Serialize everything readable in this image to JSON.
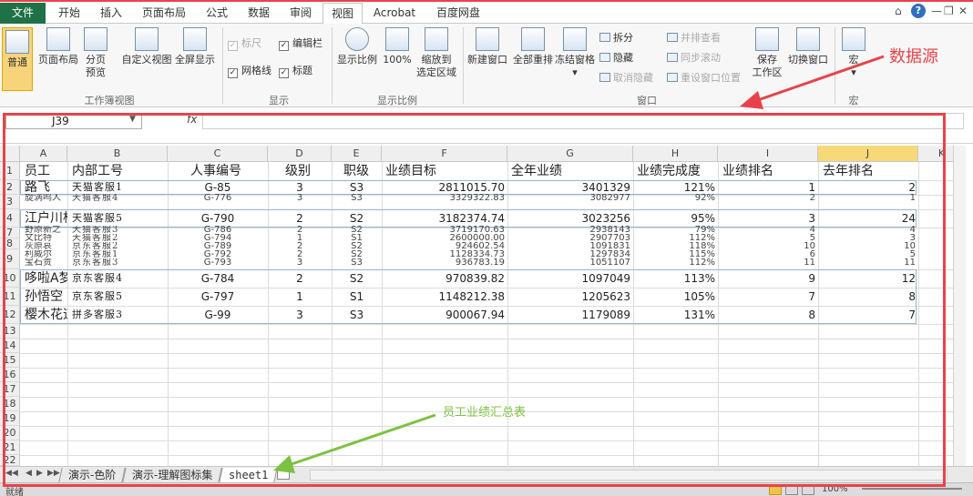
{
  "tabs": [
    "文件",
    "开始",
    "插入",
    "页面布局",
    "公式",
    "数据",
    "审阅",
    "视图",
    "Acrobat",
    "百度网盘"
  ],
  "ribbon": {
    "workbook_views": {
      "label": "工作簿视图",
      "normal": "普通",
      "page_layout": "页面布局",
      "page_break_1": "分页",
      "page_break_2": "预览",
      "custom_views": "自定义视图",
      "full_screen": "全屏显示"
    },
    "show": {
      "label": "显示",
      "ruler": "标尺",
      "formula_bar": "编辑栏",
      "gridlines": "网格线",
      "headings": "标题"
    },
    "zoom": {
      "label": "显示比例",
      "zoom": "显示比例",
      "hundred": "100%",
      "to_selection_1": "缩放到",
      "to_selection_2": "选定区域"
    },
    "window": {
      "label": "窗口",
      "new_window": "新建窗口",
      "arrange_all": "全部重排",
      "freeze_panes": "冻结窗格",
      "split": "拆分",
      "hide": "隐藏",
      "unhide": "取消隐藏",
      "side_by_side": "并排查看",
      "sync_scroll": "同步滚动",
      "reset_position": "重设窗口位置",
      "save_workspace_1": "保存",
      "save_workspace_2": "工作区",
      "switch_windows": "切换窗口"
    },
    "macros": {
      "label": "宏",
      "macro": "宏"
    }
  },
  "name_box": "J39",
  "fx": "fx",
  "columns": [
    "A",
    "B",
    "C",
    "D",
    "E",
    "F",
    "G",
    "H",
    "I",
    "J",
    "K"
  ],
  "row_numbers": [
    "1",
    "2",
    "3",
    "4",
    "7",
    "8",
    "9",
    "10",
    "11",
    "12",
    "13",
    "14",
    "15",
    "16",
    "17",
    "18",
    "19",
    "20",
    "21",
    "22"
  ],
  "headers": [
    "员工",
    "内部工号",
    "人事编号",
    "级别",
    "职级",
    "业绩目标",
    "全年业绩",
    "业绩完成度",
    "业绩排名",
    "去年排名"
  ],
  "rows": [
    [
      "路飞",
      "天猫客服1",
      "G-85",
      "3",
      "S3",
      "2811015.70",
      "3401329",
      "121%",
      "1",
      "2"
    ],
    [
      "旋涡鸣人",
      "天猫客服4",
      "G-776",
      "3",
      "S3",
      "3329322.83",
      "3082977",
      "92%",
      "2",
      "1"
    ],
    [
      "江户川柯",
      "天猫客服5",
      "G-790",
      "2",
      "S2",
      "3182374.74",
      "3023256",
      "95%",
      "3",
      "24"
    ],
    [
      "哆啦A梦",
      "京东客服4",
      "G-784",
      "2",
      "S2",
      "970839.82",
      "1097049",
      "113%",
      "9",
      "12"
    ],
    [
      "孙悟空",
      "京东客服5",
      "G-797",
      "1",
      "S1",
      "1148212.38",
      "1205623",
      "105%",
      "7",
      "8"
    ],
    [
      "樱木花道",
      "拼多客服3",
      "G-99",
      "3",
      "S3",
      "900067.94",
      "1179089",
      "131%",
      "8",
      "7"
    ]
  ],
  "overlap_rows": [
    [
      "野原新之",
      "天猫客服3",
      "G-786",
      "2",
      "S2",
      "3719170.63",
      "2938143",
      "79%",
      "4",
      "4"
    ],
    [
      "文比特",
      "天猫客服2",
      "G-794",
      "1",
      "S1",
      "2600000.00",
      "2907703",
      "112%",
      "5",
      "3"
    ],
    [
      "灰原哀",
      "京东客服2",
      "G-789",
      "2",
      "S2",
      "924602.54",
      "1091831",
      "118%",
      "10",
      "10"
    ],
    [
      "利威尔",
      "京东客服1",
      "G-792",
      "2",
      "S2",
      "1128334.73",
      "1297834",
      "115%",
      "6",
      "5"
    ],
    [
      "宝石贵",
      "京东客服3",
      "G-793",
      "3",
      "S3",
      "936783.19",
      "1051107",
      "112%",
      "11",
      "11"
    ]
  ],
  "sheets": [
    "演示-色阶",
    "演示-理解图标集",
    "sheet1"
  ],
  "status": {
    "ready": "就绪",
    "zoom": "100%"
  },
  "annotations": {
    "data_source": "数据源",
    "summary_table": "员工业绩汇总表"
  },
  "colors": {
    "accent_green": "#1f7246",
    "annotation_red": "#e8434a",
    "annotation_green": "#7dc243",
    "selected_header": "#f8d978"
  }
}
